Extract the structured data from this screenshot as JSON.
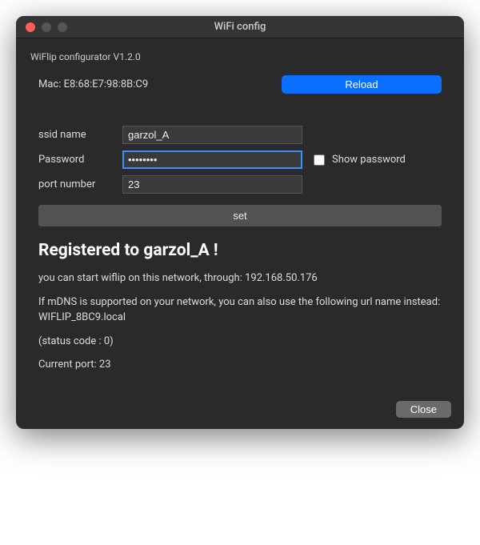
{
  "window": {
    "title": "WiFi config"
  },
  "app": {
    "name_version": "WiFlip configurator V1.2.0"
  },
  "mac": {
    "label_prefix": "Mac: ",
    "address": "E8:68:E7:98:8B:C9"
  },
  "buttons": {
    "reload": "Reload",
    "set": "set",
    "close": "Close"
  },
  "form": {
    "ssid_label": "ssid name",
    "ssid_value": "garzol_A",
    "password_label": "Password",
    "password_value": "••••••••",
    "show_password_label": "Show password",
    "show_password_checked": false,
    "port_label": "port number",
    "port_value": "23"
  },
  "status": {
    "heading": "Registered to garzol_A !",
    "line_start": "you can start wiflip on this network, through: 192.168.50.176",
    "line_mdns": "If mDNS is supported on your network, you can also use the following url name instead:",
    "line_mdns_name": "WIFLIP_8BC9.local",
    "line_code": "(status code : 0)",
    "line_port": "Current port: 23"
  }
}
